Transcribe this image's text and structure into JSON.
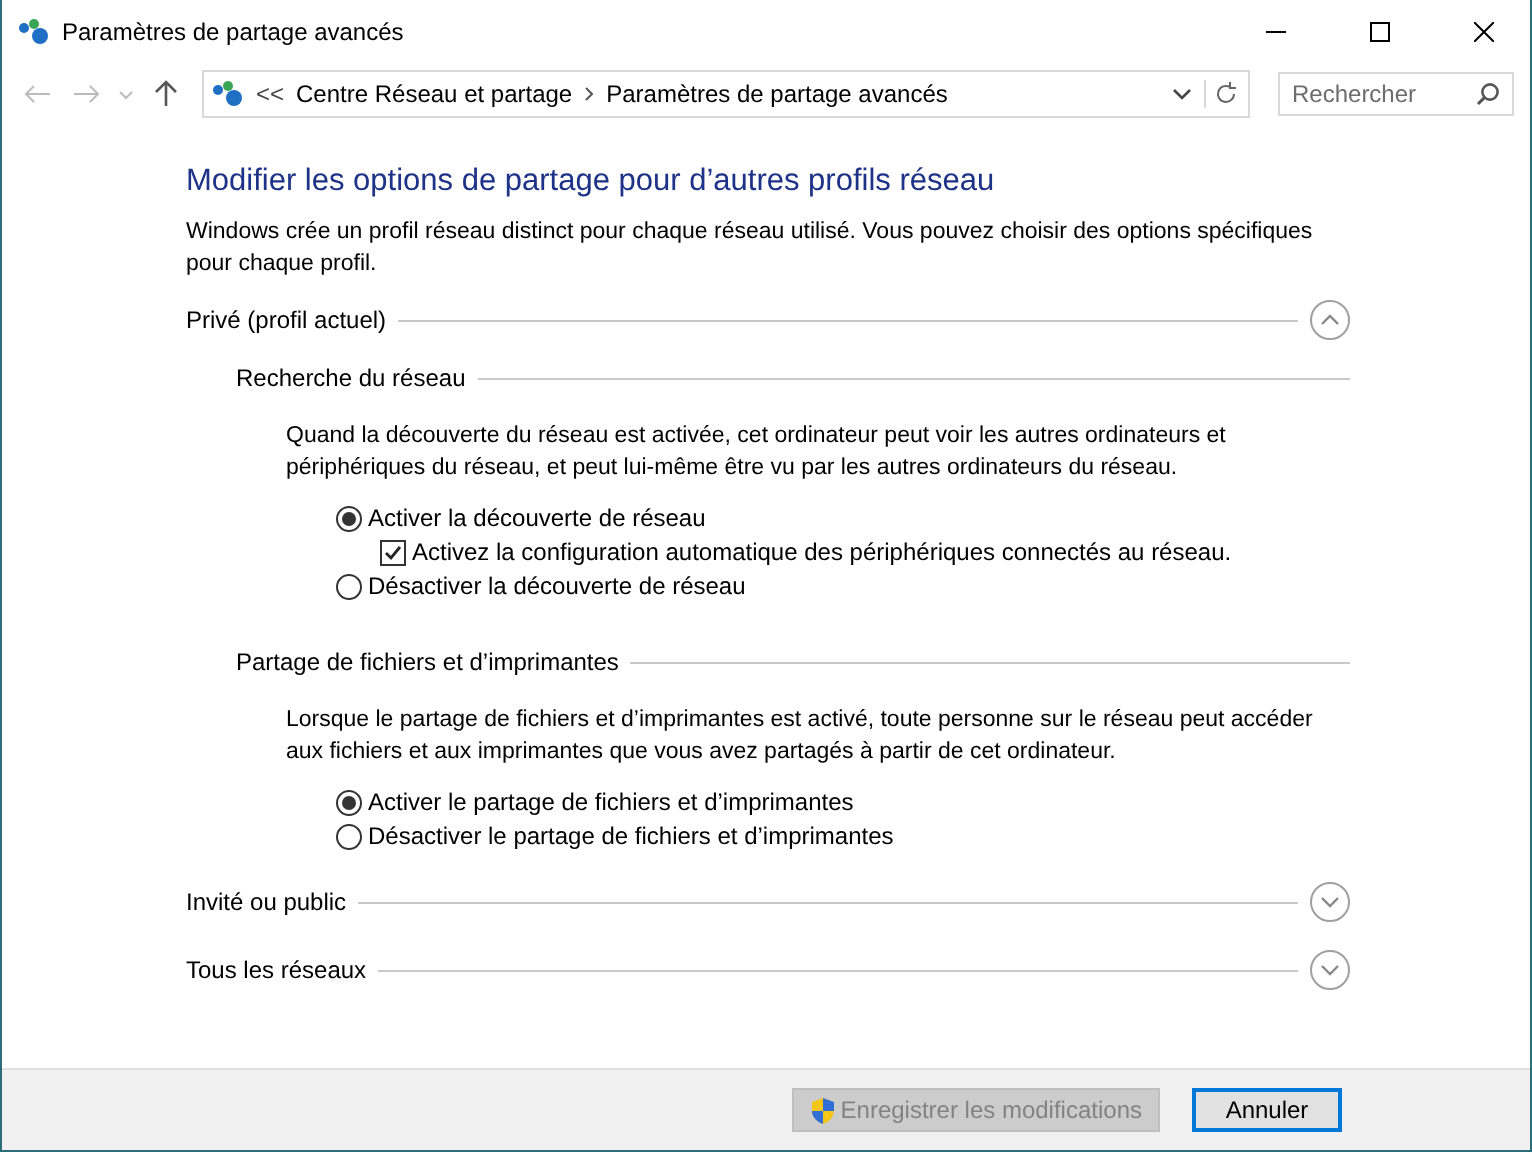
{
  "window": {
    "title": "Paramètres de partage avancés"
  },
  "address_bar": {
    "overflow": "<<",
    "crumbs": [
      "Centre Réseau et partage",
      "Paramètres de partage avancés"
    ]
  },
  "search": {
    "placeholder": "Rechercher"
  },
  "heading": "Modifier les options de partage pour d’autres profils réseau",
  "intro": "Windows crée un profil réseau distinct pour chaque réseau utilisé. Vous pouvez choisir des options spécifiques pour chaque profil.",
  "sections": [
    {
      "title": "Privé (profil actuel)",
      "expanded": true,
      "subsections": [
        {
          "title": "Recherche du réseau",
          "description": "Quand la découverte du réseau est activée, cet ordinateur peut voir les autres ordinateurs et périphériques du réseau, et peut lui-même être vu par les autres ordinateurs du réseau.",
          "options": [
            {
              "kind": "radio",
              "label": "Activer la découverte de réseau",
              "selected": true,
              "children": [
                {
                  "kind": "checkbox",
                  "label": "Activez la configuration automatique des périphériques connectés au réseau.",
                  "checked": true
                }
              ]
            },
            {
              "kind": "radio",
              "label": "Désactiver la découverte de réseau",
              "selected": false
            }
          ]
        },
        {
          "title": "Partage de fichiers et d’imprimantes",
          "description": "Lorsque le partage de fichiers et d’imprimantes est activé, toute personne sur le réseau peut accéder aux fichiers et aux imprimantes que vous avez partagés à partir de cet ordinateur.",
          "options": [
            {
              "kind": "radio",
              "label": "Activer le partage de fichiers et d’imprimantes",
              "selected": true
            },
            {
              "kind": "radio",
              "label": "Désactiver le partage de fichiers et d’imprimantes",
              "selected": false
            }
          ]
        }
      ]
    },
    {
      "title": "Invité ou public",
      "expanded": false
    },
    {
      "title": "Tous les réseaux",
      "expanded": false
    }
  ],
  "footer": {
    "buttons": [
      {
        "label": "Enregistrer les modifications",
        "disabled": true,
        "shield": true
      },
      {
        "label": "Annuler",
        "disabled": false,
        "shield": false
      }
    ]
  }
}
